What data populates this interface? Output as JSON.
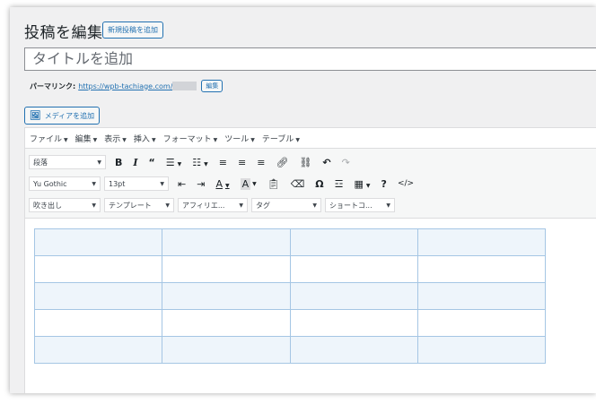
{
  "header": {
    "title": "投稿を編集",
    "add_new_label": "新規投稿を追加"
  },
  "title_field": {
    "placeholder": "タイトルを追加"
  },
  "permalink": {
    "label": "パーマリンク:",
    "url": "https://wpb-tachiage.com/",
    "edit_label": "編集"
  },
  "media": {
    "label": "メディアを追加",
    "icon": "media-icon"
  },
  "menubar": {
    "items": [
      "ファイル",
      "編集",
      "表示",
      "挿入",
      "フォーマット",
      "ツール",
      "テーブル"
    ]
  },
  "toolbar1": {
    "format_select": "段落",
    "icons": [
      "bold-icon",
      "italic-icon",
      "blockquote-icon",
      "bullet-list-icon",
      "numbered-list-icon",
      "align-left-icon",
      "align-center-icon",
      "align-right-icon",
      "link-icon",
      "unlink-icon",
      "undo-icon",
      "redo-icon"
    ]
  },
  "toolbar2": {
    "font_select": "Yu Gothic",
    "size_select": "13pt",
    "icons": [
      "outdent-icon",
      "indent-icon",
      "text-color-icon",
      "background-color-icon",
      "paste-text-icon",
      "clear-format-icon",
      "special-char-icon",
      "horizontal-rule-icon",
      "table-icon",
      "help-icon",
      "code-icon"
    ]
  },
  "toolbar3": {
    "selects": [
      "吹き出し",
      "テンプレート",
      "アフィリエ...",
      "タグ",
      "ショートコ..."
    ]
  },
  "table": {
    "rows": 5,
    "cols": 4
  },
  "colors": {
    "accent": "#2271b1",
    "table_border": "#a5c6e4",
    "table_stripe": "#eef5fb"
  }
}
